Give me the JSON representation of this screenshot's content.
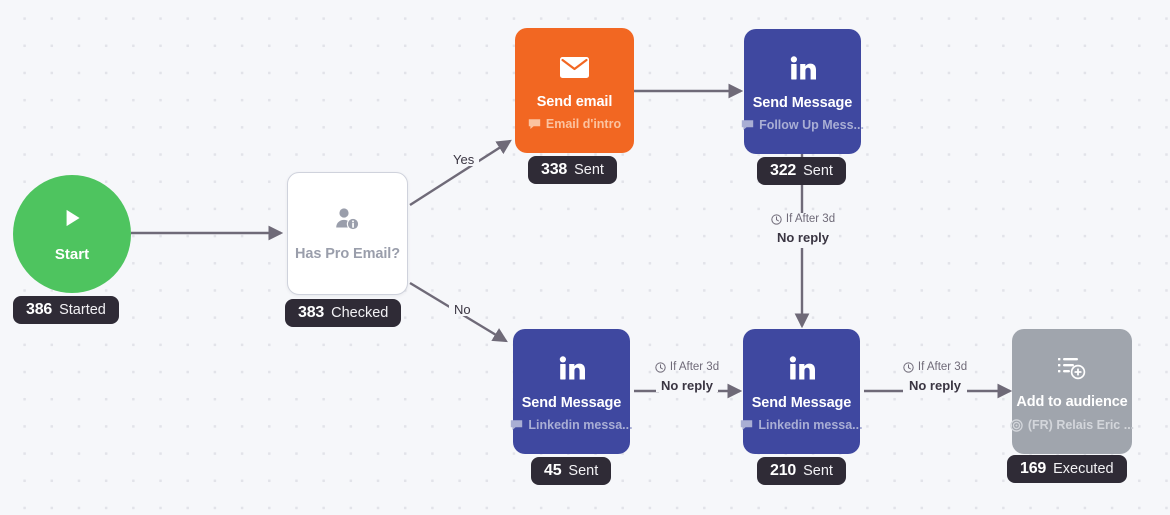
{
  "canvas": {
    "background_color": "#f6f7fa",
    "dot_color": "#e2e3e9"
  },
  "colors": {
    "orange": "#f26722",
    "indigo": "#3f48a0",
    "gray": "#a0a5ad",
    "green": "#4ec45f",
    "badge": "#2f2b36",
    "edge": "#6f6a78"
  },
  "nodes": {
    "start": {
      "title": "Start",
      "icon": "play-icon",
      "badge": {
        "count": "386",
        "label": "Started"
      }
    },
    "has_pro_email": {
      "title": "Has Pro Email?",
      "icon": "person-info-icon",
      "badge": {
        "count": "383",
        "label": "Checked"
      }
    },
    "send_email": {
      "title": "Send email",
      "subtitle": "Email d'intro",
      "icon": "envelope-icon",
      "subtitle_icon": "speech-bubble-icon",
      "badge": {
        "count": "338",
        "label": "Sent"
      }
    },
    "follow_up_message": {
      "title": "Send Message",
      "subtitle": "Follow Up Mess...",
      "icon": "linkedin-icon",
      "subtitle_icon": "speech-bubble-icon",
      "badge": {
        "count": "322",
        "label": "Sent"
      }
    },
    "linkedin_message_1": {
      "title": "Send Message",
      "subtitle": "Linkedin messa...",
      "icon": "linkedin-icon",
      "subtitle_icon": "speech-bubble-icon",
      "badge": {
        "count": "45",
        "label": "Sent"
      }
    },
    "linkedin_message_2": {
      "title": "Send Message",
      "subtitle": "Linkedin messa...",
      "icon": "linkedin-icon",
      "subtitle_icon": "speech-bubble-icon",
      "badge": {
        "count": "210",
        "label": "Sent"
      }
    },
    "add_to_audience": {
      "title": "Add to audience",
      "subtitle": "(FR) Relais Eric ...",
      "icon": "list-add-icon",
      "subtitle_icon": "target-icon",
      "badge": {
        "count": "169",
        "label": "Executed"
      }
    }
  },
  "edge_labels": {
    "yes": {
      "main": "Yes"
    },
    "no": {
      "main": "No"
    },
    "wait_vertical": {
      "condition": "If After 3d",
      "main": "No reply",
      "icon": "clock-icon"
    },
    "wait_horizontal_1": {
      "condition": "If After 3d",
      "main": "No reply",
      "icon": "clock-icon"
    },
    "wait_horizontal_2": {
      "condition": "If After 3d",
      "main": "No reply",
      "icon": "clock-icon"
    }
  }
}
